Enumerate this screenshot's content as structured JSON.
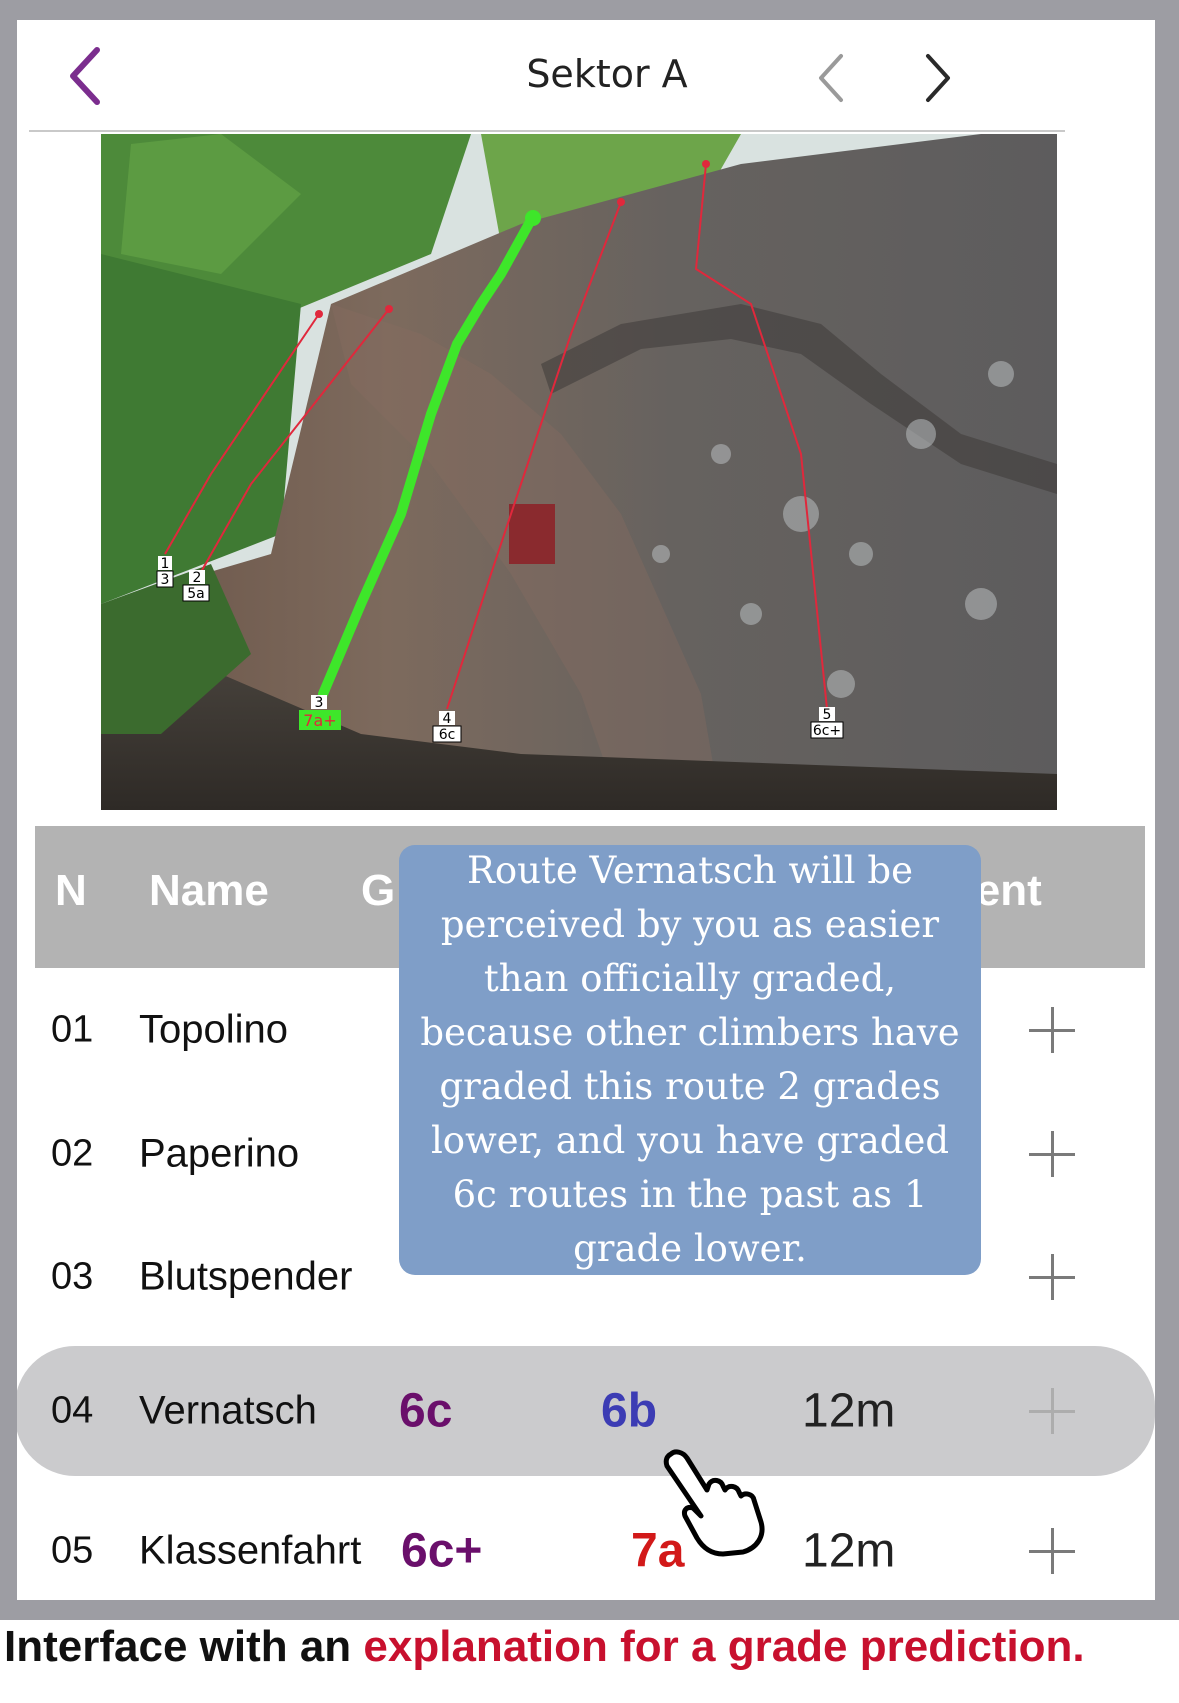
{
  "header": {
    "title": "Sektor A"
  },
  "photo": {
    "route_markers": [
      {
        "number": "1",
        "grade": "3"
      },
      {
        "number": "2",
        "grade": "5a"
      },
      {
        "number": "3",
        "grade": "7a+"
      },
      {
        "number": "4",
        "grade": "6c"
      },
      {
        "number": "5",
        "grade": "6c+"
      }
    ]
  },
  "table": {
    "headers": {
      "number": "N",
      "name": "Name",
      "grade": "G",
      "ascent": "Ascent"
    },
    "rows": [
      {
        "number": "01",
        "name": "Topolino",
        "grade": "",
        "predicted": "",
        "length": ""
      },
      {
        "number": "02",
        "name": "Paperino",
        "grade": "",
        "predicted": "",
        "length": ""
      },
      {
        "number": "03",
        "name": "Blutspender",
        "grade": "",
        "predicted": "",
        "length": ""
      },
      {
        "number": "04",
        "name": "Vernatsch",
        "grade": "6c",
        "predicted": "6b",
        "length": "12m"
      },
      {
        "number": "05",
        "name": "Klassenfahrt",
        "grade": "6c+",
        "predicted": "7a",
        "length": "12m"
      }
    ]
  },
  "tooltip": {
    "text": "Route Vernatsch will be perceived by you as easier than officially graded, because other climbers have graded this route 2 grades lower, and you have graded 6c routes in the past as 1 grade lower."
  },
  "caption": {
    "prefix": "Interface with an ",
    "highlight": "explanation for a grade prediction."
  },
  "colors": {
    "accent": "#7b2d8e",
    "grade": "#6a0f6b",
    "predicted_easier": "#3c3cb4",
    "predicted_harder": "#d21919",
    "tooltip_bg": "#7f9ec8",
    "route_highlight": "#3ee62a",
    "route_line": "#e0283c"
  }
}
